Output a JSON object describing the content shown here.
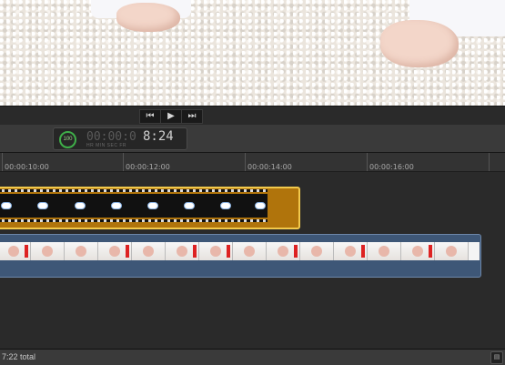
{
  "viewer": {
    "description_icon": "video-frame"
  },
  "transport": {
    "prev_icon": "skip-back-icon",
    "play_icon": "play-icon",
    "next_icon": "skip-forward-icon",
    "prev_glyph": "⏮",
    "play_glyph": "▶",
    "next_glyph": "⏭"
  },
  "dashboard": {
    "percent": "100",
    "timecode_dim": "00:00:0",
    "timecode_value": "8:24",
    "units": "HR   MIN   SEC   FR"
  },
  "ruler": {
    "labels": [
      "00:00:10:00",
      "00:00:12:00",
      "00:00:14:00",
      "00:00:16:00"
    ]
  },
  "status": {
    "total": "7:22 total"
  },
  "colors": {
    "title_clip": "#b0740c",
    "title_clip_selected_border": "#f2c94c",
    "video_clip": "#3e5777"
  }
}
